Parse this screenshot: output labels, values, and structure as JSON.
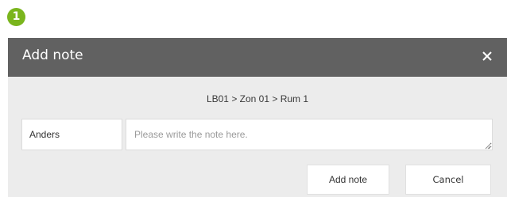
{
  "step": {
    "number": "1",
    "color": "#7ab51d"
  },
  "dialog": {
    "title": "Add note",
    "close_icon": "close-icon",
    "header_color": "#616161",
    "background_color": "#ececec"
  },
  "breadcrumb": "LB01 > Zon 01 > Rum 1",
  "form": {
    "author": "Anders",
    "note_value": "",
    "note_placeholder": "Please write the note here."
  },
  "buttons": {
    "add_note_label": "Add note",
    "cancel_label": "Cancel"
  }
}
